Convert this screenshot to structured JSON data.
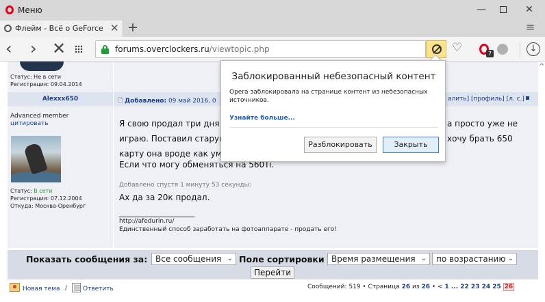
{
  "window": {
    "menu_label": "Меню",
    "minimize": "—",
    "close": "✕"
  },
  "tab": {
    "title": "Флейм - Всё о GeForce GT",
    "close": "✕",
    "new_tab": "+",
    "menu": "≡"
  },
  "nav": {
    "back": "‹",
    "forward": "›",
    "stop": "✕",
    "url_host": "forums.overclockers.ru",
    "url_path": "/viewtopic.php",
    "heart": "♡",
    "ext_badge": "7",
    "download": "↓"
  },
  "prev_post": {
    "status": "Статус: Не в сети",
    "registration": "Регистрация: 09.04.2014"
  },
  "post": {
    "author": "Alexxx650",
    "header_label": "Добавлено:",
    "header_date": "09 май 2016, 0",
    "links": "алить] [профиль] [л. с.]",
    "rank": "Advanced member",
    "quote": "цитировать",
    "status_label": "Статус:",
    "status_value": "В сети",
    "registration": "Регистрация: 07.12.2004",
    "location": "Откуда: Москва-Оренбург",
    "line1_start": "Я свою продал три дня",
    "line1_end": "а просто уже не",
    "line2_start": "играю. Поставил старун",
    "line2_end": "хочу брать 650",
    "line3": "карту она вроде как ум",
    "line4": "Если что могу обменяться на 560Ti.",
    "added_later": "Добавлено спустя 1 минуту 53 секунды:",
    "line5": "Ах да за 20к продал.",
    "sig_url": "http://afedurin.ru/",
    "sig_text": "Единственный способ заработать на фотоаппарате - продать его!"
  },
  "sort": {
    "show_label": "Показать сообщения за:",
    "show_value": "Все сообщения",
    "field_label": "Поле сортировки",
    "field_value": "Время размещения",
    "order_value": "по возрастанию",
    "go": "Перейти"
  },
  "footer": {
    "new_topic": "Новая тема",
    "separator": "/",
    "reply": "Ответить",
    "messages": "Сообщений: 519 • Страница",
    "page": "26",
    "of": "из",
    "total": "26",
    "bullet": "• <",
    "pages_tail": "1 ... 22 23 24 25",
    "current": "26"
  },
  "popup": {
    "title": "Заблокированный небезопасный контент",
    "text": "Opera заблокировала на странице контент из небезопасных источников.",
    "learn_more": "Узнайте больше...",
    "unblock": "Разблокировать",
    "close": "Закрыть"
  }
}
